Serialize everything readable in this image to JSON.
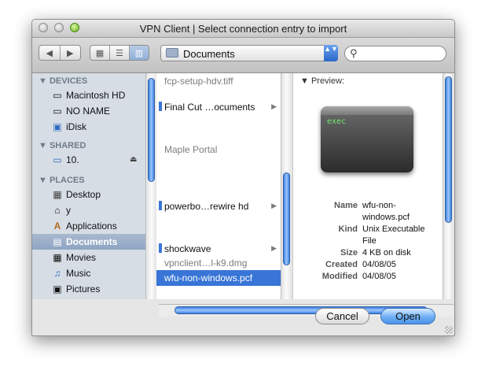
{
  "window": {
    "title": "VPN Client  |  Select connection entry to import"
  },
  "toolbar": {
    "back_icon": "◀",
    "forward_icon": "▶",
    "view_icon_view": "▦",
    "view_list_view": "☰",
    "view_column_view": "▥",
    "location": "Documents",
    "popup_arrows": "▲▼",
    "search_icon": "⚲",
    "search_value": ""
  },
  "sidebar": {
    "devices_heading": "▼ DEVICES",
    "devices": [
      {
        "label": "Macintosh HD",
        "icon": "▭"
      },
      {
        "label": "NO NAME",
        "icon": "▭"
      },
      {
        "label": "iDisk",
        "icon": "▣"
      }
    ],
    "shared_heading": "▼ SHARED",
    "shared": [
      {
        "label": "10.",
        "icon": "▭",
        "eject": "⏏"
      }
    ],
    "places_heading": "▼ PLACES",
    "places": [
      {
        "label": "Desktop",
        "icon": "▦"
      },
      {
        "label": "y",
        "icon": "⌂"
      },
      {
        "label": "Applications",
        "icon": "A"
      },
      {
        "label": "Documents",
        "icon": "▤"
      },
      {
        "label": "Movies",
        "icon": "▦"
      },
      {
        "label": "Music",
        "icon": "♫"
      },
      {
        "label": "Pictures",
        "icon": "▣"
      }
    ]
  },
  "files": {
    "items": [
      {
        "label": "fcp-setup-hdv.tiff",
        "arrow": ""
      },
      {
        "label": "Final Cut …ocuments",
        "arrow": "▶"
      },
      {
        "label": "Maple Portal",
        "arrow": ""
      },
      {
        "label": "powerbo…rewire hd",
        "arrow": "▶"
      },
      {
        "label": "shockwave",
        "arrow": "▶"
      },
      {
        "label": "vpnclient…l-k9.dmg",
        "arrow": ""
      },
      {
        "label": "wfu-non-windows.pcf",
        "arrow": ""
      }
    ]
  },
  "preview": {
    "heading": "▼ Preview:",
    "icon_text": "exec",
    "name_label": "Name",
    "name_value_1": "wfu-non-",
    "name_value_2": "windows.pcf",
    "kind_label": "Kind",
    "kind_value_1": "Unix Executable",
    "kind_value_2": "File",
    "size_label": "Size",
    "size_value": "4 KB on disk",
    "created_label": "Created",
    "created_value": "04/08/05",
    "modified_label": "Modified",
    "modified_value": "04/08/05"
  },
  "buttons": {
    "cancel": "Cancel",
    "open": "Open"
  },
  "colors": {
    "selection": "#3875d7",
    "accent": "#4c93ea",
    "sidebar_bg": "#d6dde5"
  }
}
